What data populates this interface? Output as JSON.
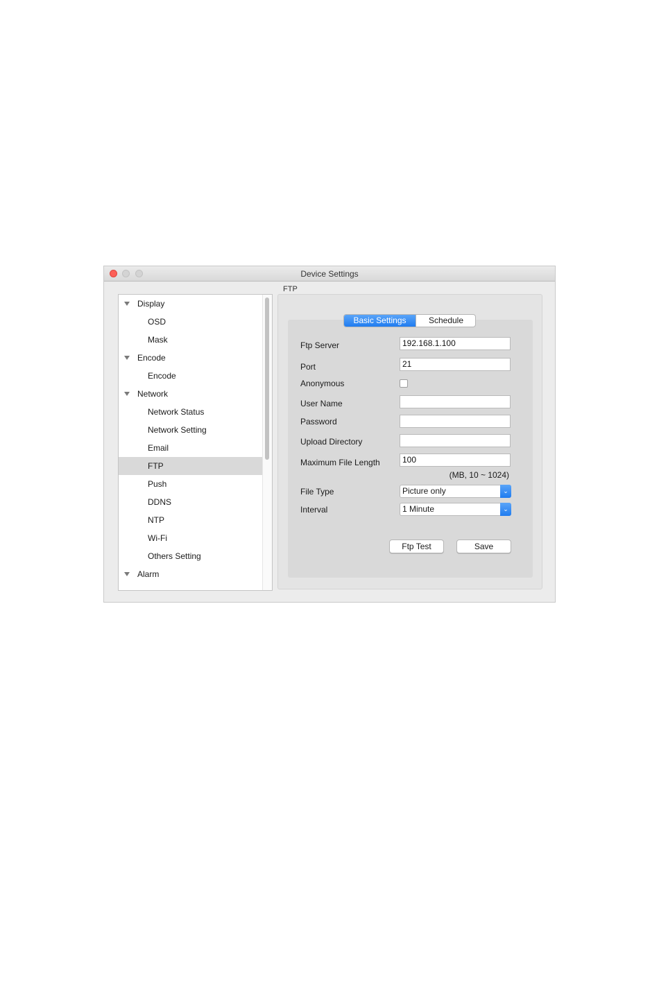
{
  "window": {
    "title": "Device Settings"
  },
  "sidebar": {
    "items": [
      {
        "label": "Display",
        "type": "group"
      },
      {
        "label": "OSD",
        "type": "child"
      },
      {
        "label": "Mask",
        "type": "child"
      },
      {
        "label": "Encode",
        "type": "group"
      },
      {
        "label": "Encode",
        "type": "child"
      },
      {
        "label": "Network",
        "type": "group"
      },
      {
        "label": "Network Status",
        "type": "child"
      },
      {
        "label": "Network Setting",
        "type": "child"
      },
      {
        "label": "Email",
        "type": "child"
      },
      {
        "label": "FTP",
        "type": "child",
        "selected": true
      },
      {
        "label": "Push",
        "type": "child"
      },
      {
        "label": "DDNS",
        "type": "child"
      },
      {
        "label": "NTP",
        "type": "child"
      },
      {
        "label": "Wi-Fi",
        "type": "child"
      },
      {
        "label": "Others Setting",
        "type": "child"
      },
      {
        "label": "Alarm",
        "type": "group"
      }
    ]
  },
  "panel": {
    "section_title": "FTP",
    "tabs": [
      {
        "label": "Basic Settings",
        "active": true
      },
      {
        "label": "Schedule",
        "active": false
      }
    ],
    "fields": {
      "ftp_server": {
        "label": "Ftp Server",
        "value": "192.168.1.100"
      },
      "port": {
        "label": "Port",
        "value": "21"
      },
      "anonymous": {
        "label": "Anonymous",
        "checked": false
      },
      "user_name": {
        "label": "User Name",
        "value": ""
      },
      "password": {
        "label": "Password",
        "value": ""
      },
      "upload_directory": {
        "label": "Upload Directory",
        "value": ""
      },
      "max_file_length": {
        "label": "Maximum File Length",
        "value": "100",
        "hint": "(MB, 10 ~ 1024)"
      },
      "file_type": {
        "label": "File Type",
        "value": "Picture only"
      },
      "interval": {
        "label": "Interval",
        "value": "1 Minute"
      }
    },
    "buttons": {
      "ftp_test": "Ftp Test",
      "save": "Save"
    }
  },
  "colors": {
    "accent": "#1f7cf0",
    "close": "#fc5f57",
    "selection": "#d9d9d9"
  }
}
